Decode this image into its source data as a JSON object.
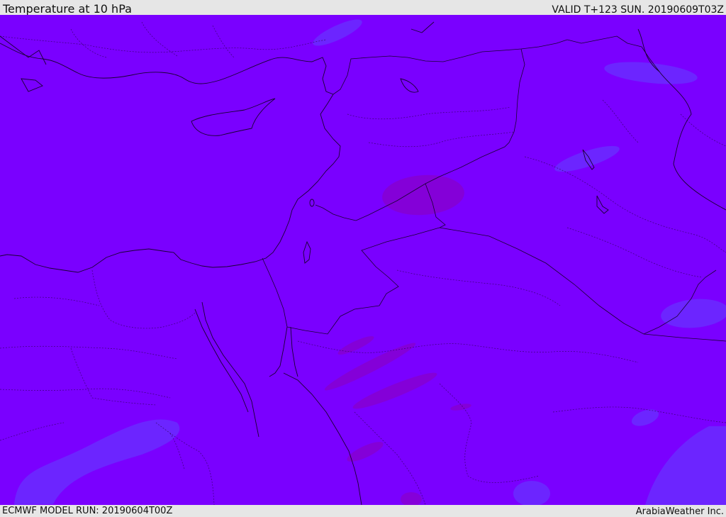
{
  "header": {
    "title": "Temperature at 10 hPa",
    "valid": "VALID T+123 SUN. 20190609T03Z"
  },
  "footer": {
    "model_run": "ECMWF MODEL RUN: 20190604T00Z",
    "credit": "ArabiaWeather Inc."
  },
  "map": {
    "colors": {
      "base_field": "#7a00ff",
      "cooler_blue": "#6a28ff",
      "warmer_magenta": "#8400d6",
      "lines": "#1a0033"
    }
  }
}
